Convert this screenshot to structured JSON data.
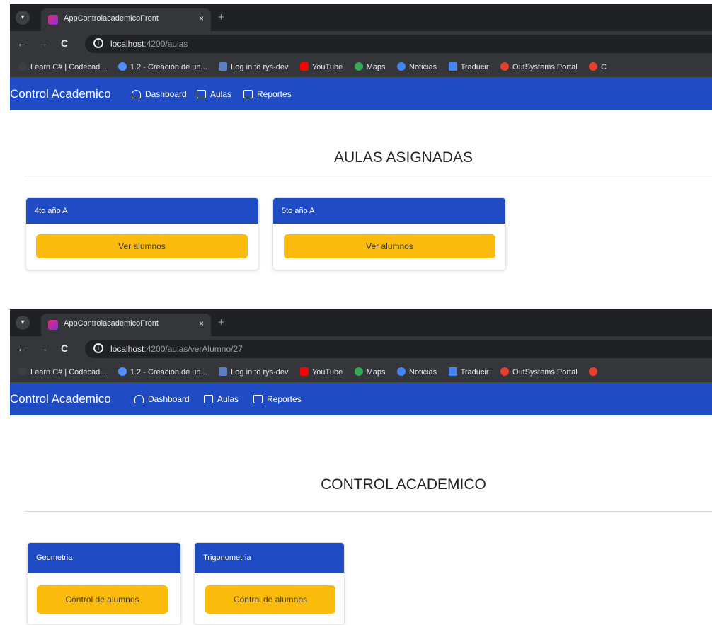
{
  "browser1": {
    "tab_title": "AppControlacademicoFront",
    "tab_close": "×",
    "new_tab": "+",
    "url_host": "localhost",
    "url_path": ":4200/aulas",
    "bookmarks": [
      {
        "label": "Learn C# | Codecad...",
        "color": "#3c4043"
      },
      {
        "label": "1.2 - Creación de un...",
        "color": "#4d90fe"
      },
      {
        "label": "Log in to rys-dev",
        "color": "#5b7fbf"
      },
      {
        "label": "YouTube",
        "color": "#ff0000"
      },
      {
        "label": "Maps",
        "color": "#34a853"
      },
      {
        "label": "Noticias",
        "color": "#4285f4"
      },
      {
        "label": "Traducir",
        "color": "#4285f4"
      },
      {
        "label": "OutSystems Portal",
        "color": "#e83e2d"
      },
      {
        "label": "C",
        "color": "#e83e2d"
      }
    ]
  },
  "app1": {
    "brand": "Control Academico",
    "nav": {
      "dashboard": "Dashboard",
      "aulas": "Aulas",
      "reportes": "Reportes"
    },
    "title": "AULAS ASIGNADAS",
    "cards": [
      {
        "header": "4to año A",
        "button": "Ver alumnos"
      },
      {
        "header": "5to año A",
        "button": "Ver alumnos"
      }
    ]
  },
  "browser2": {
    "tab_title": "AppControlacademicoFront",
    "tab_close": "×",
    "new_tab": "+",
    "url_host": "localhost",
    "url_path": ":4200/aulas/verAlumno/27",
    "bookmarks": [
      {
        "label": "Learn C# | Codecad...",
        "color": "#3c4043"
      },
      {
        "label": "1.2 - Creación de un...",
        "color": "#4d90fe"
      },
      {
        "label": "Log in to rys-dev",
        "color": "#5b7fbf"
      },
      {
        "label": "YouTube",
        "color": "#ff0000"
      },
      {
        "label": "Maps",
        "color": "#34a853"
      },
      {
        "label": "Noticias",
        "color": "#4285f4"
      },
      {
        "label": "Traducir",
        "color": "#4285f4"
      },
      {
        "label": "OutSystems Portal",
        "color": "#e83e2d"
      }
    ]
  },
  "app2": {
    "brand": "Control Academico",
    "nav": {
      "dashboard": "Dashboard",
      "aulas": "Aulas",
      "reportes": "Reportes"
    },
    "title": "CONTROL ACADEMICO",
    "cards": [
      {
        "header": "Geometria",
        "button": "Control de alumnos"
      },
      {
        "header": "Trigonometria",
        "button": "Control de alumnos"
      }
    ]
  },
  "colors": {
    "app_nav": "#1f4bc4",
    "button": "#fbbb0d",
    "browser_dark": "#202124"
  }
}
